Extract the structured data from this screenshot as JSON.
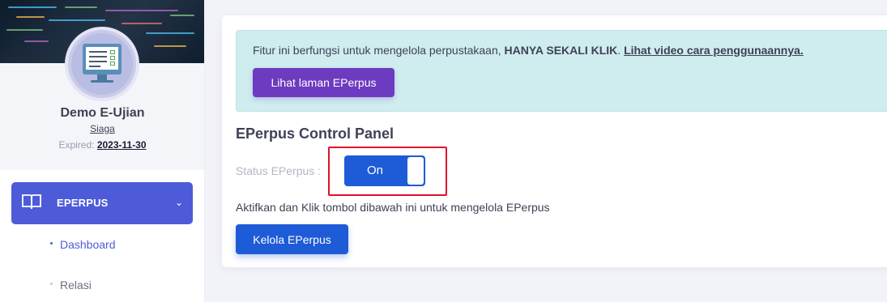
{
  "sidebar": {
    "profile": {
      "name": "Demo E-Ujian",
      "tier": "Siaga",
      "expired_label": "Expired:",
      "expired_date": "2023-11-30",
      "avatar_icon": "online-test-monitor-icon"
    },
    "menu": {
      "active_label": "EPERPUS",
      "active_icon": "book-icon",
      "expand_icon": "chevron-down-icon",
      "subitems": [
        {
          "label": "Dashboard",
          "active": true
        },
        {
          "label": "Relasi",
          "active": false
        }
      ]
    }
  },
  "main": {
    "alert": {
      "text_before": "Fitur ini berfungsi untuk mengelola perpustakaan, ",
      "text_strong": "HANYA SEKALI KLIK",
      "text_after": ". ",
      "link_text": "Lihat video cara penggunaannya.",
      "button_label": "Lihat laman EPerpus"
    },
    "panel_title": "EPerpus Control Panel",
    "status_label": "Status EPerpus :",
    "toggle_label": "On",
    "instruction": "Aktifkan dan Klik tombol dibawah ini untuk mengelola EPerpus",
    "manage_button": "Kelola EPerpus"
  },
  "colors": {
    "primary": "#1e5bd6",
    "menu_active": "#4e5bd8",
    "purple_button": "#6c3bbf",
    "alert_bg": "#cfecef",
    "highlight": "#e0102b"
  }
}
